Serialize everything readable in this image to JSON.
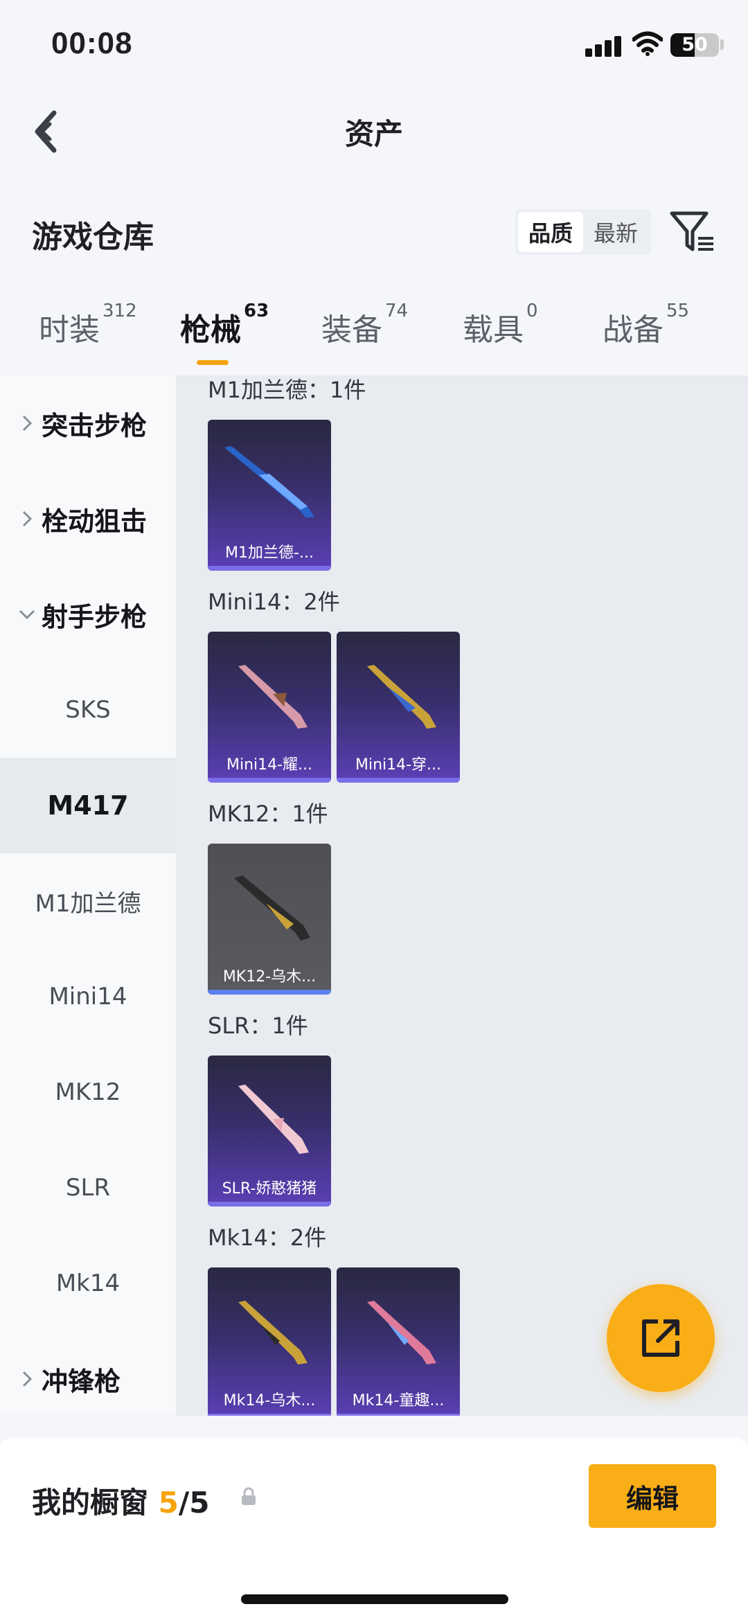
{
  "status": {
    "time": "00:08",
    "battery": "50",
    "battery_level": 0.5
  },
  "header": {
    "title": "资产",
    "back_icon": "chevron-left-icon"
  },
  "section": {
    "title": "游戏仓库",
    "sort_options": [
      "品质",
      "最新"
    ],
    "sort_active": "品质",
    "filter_icon": "filter-icon"
  },
  "tabs": [
    {
      "label": "时装",
      "count": "312"
    },
    {
      "label": "枪械",
      "count": "63",
      "active": true
    },
    {
      "label": "装备",
      "count": "74"
    },
    {
      "label": "载具",
      "count": "0"
    },
    {
      "label": "战备",
      "count": "55"
    }
  ],
  "sidebar": {
    "items": [
      {
        "label": "突击步枪",
        "type": "group",
        "expanded": false
      },
      {
        "label": "栓动狙击",
        "type": "group",
        "expanded": false
      },
      {
        "label": "射手步枪",
        "type": "group",
        "expanded": true
      },
      {
        "label": "SKS",
        "type": "sub"
      },
      {
        "label": "M417",
        "type": "sub",
        "selected": true
      },
      {
        "label": "M1加兰德",
        "type": "sub"
      },
      {
        "label": "Mini14",
        "type": "sub"
      },
      {
        "label": "MK12",
        "type": "sub"
      },
      {
        "label": "SLR",
        "type": "sub"
      },
      {
        "label": "Mk14",
        "type": "sub"
      },
      {
        "label": "冲锋枪",
        "type": "group",
        "expanded": false
      }
    ]
  },
  "content": {
    "groups": [
      {
        "label": "M1加兰德：1件",
        "items": [
          {
            "name": "M1加兰德-...",
            "rarity": "purple"
          }
        ]
      },
      {
        "label": "Mini14：2件",
        "items": [
          {
            "name": "Mini14-耀...",
            "rarity": "purple"
          },
          {
            "name": "Mini14-穿...",
            "rarity": "purple"
          }
        ]
      },
      {
        "label": "MK12：1件",
        "items": [
          {
            "name": "MK12-乌木...",
            "rarity": "gray"
          }
        ]
      },
      {
        "label": "SLR：1件",
        "items": [
          {
            "name": "SLR-娇憨猪猪",
            "rarity": "purple"
          }
        ]
      },
      {
        "label": "Mk14：2件",
        "items": [
          {
            "name": "Mk14-乌木...",
            "rarity": "purple"
          },
          {
            "name": "Mk14-童趣...",
            "rarity": "purple"
          }
        ]
      }
    ]
  },
  "fab": {
    "icon": "share-icon"
  },
  "bottom": {
    "showcase_label": "我的橱窗",
    "current": "5",
    "total": "/5",
    "lock_icon": "lock-icon",
    "edit_label": "编辑"
  },
  "colors": {
    "accent": "#f9ae17",
    "tab_underline": "#f5a40f",
    "card_purple": "#5b3fb6",
    "card_gray": "#5a5a60"
  }
}
